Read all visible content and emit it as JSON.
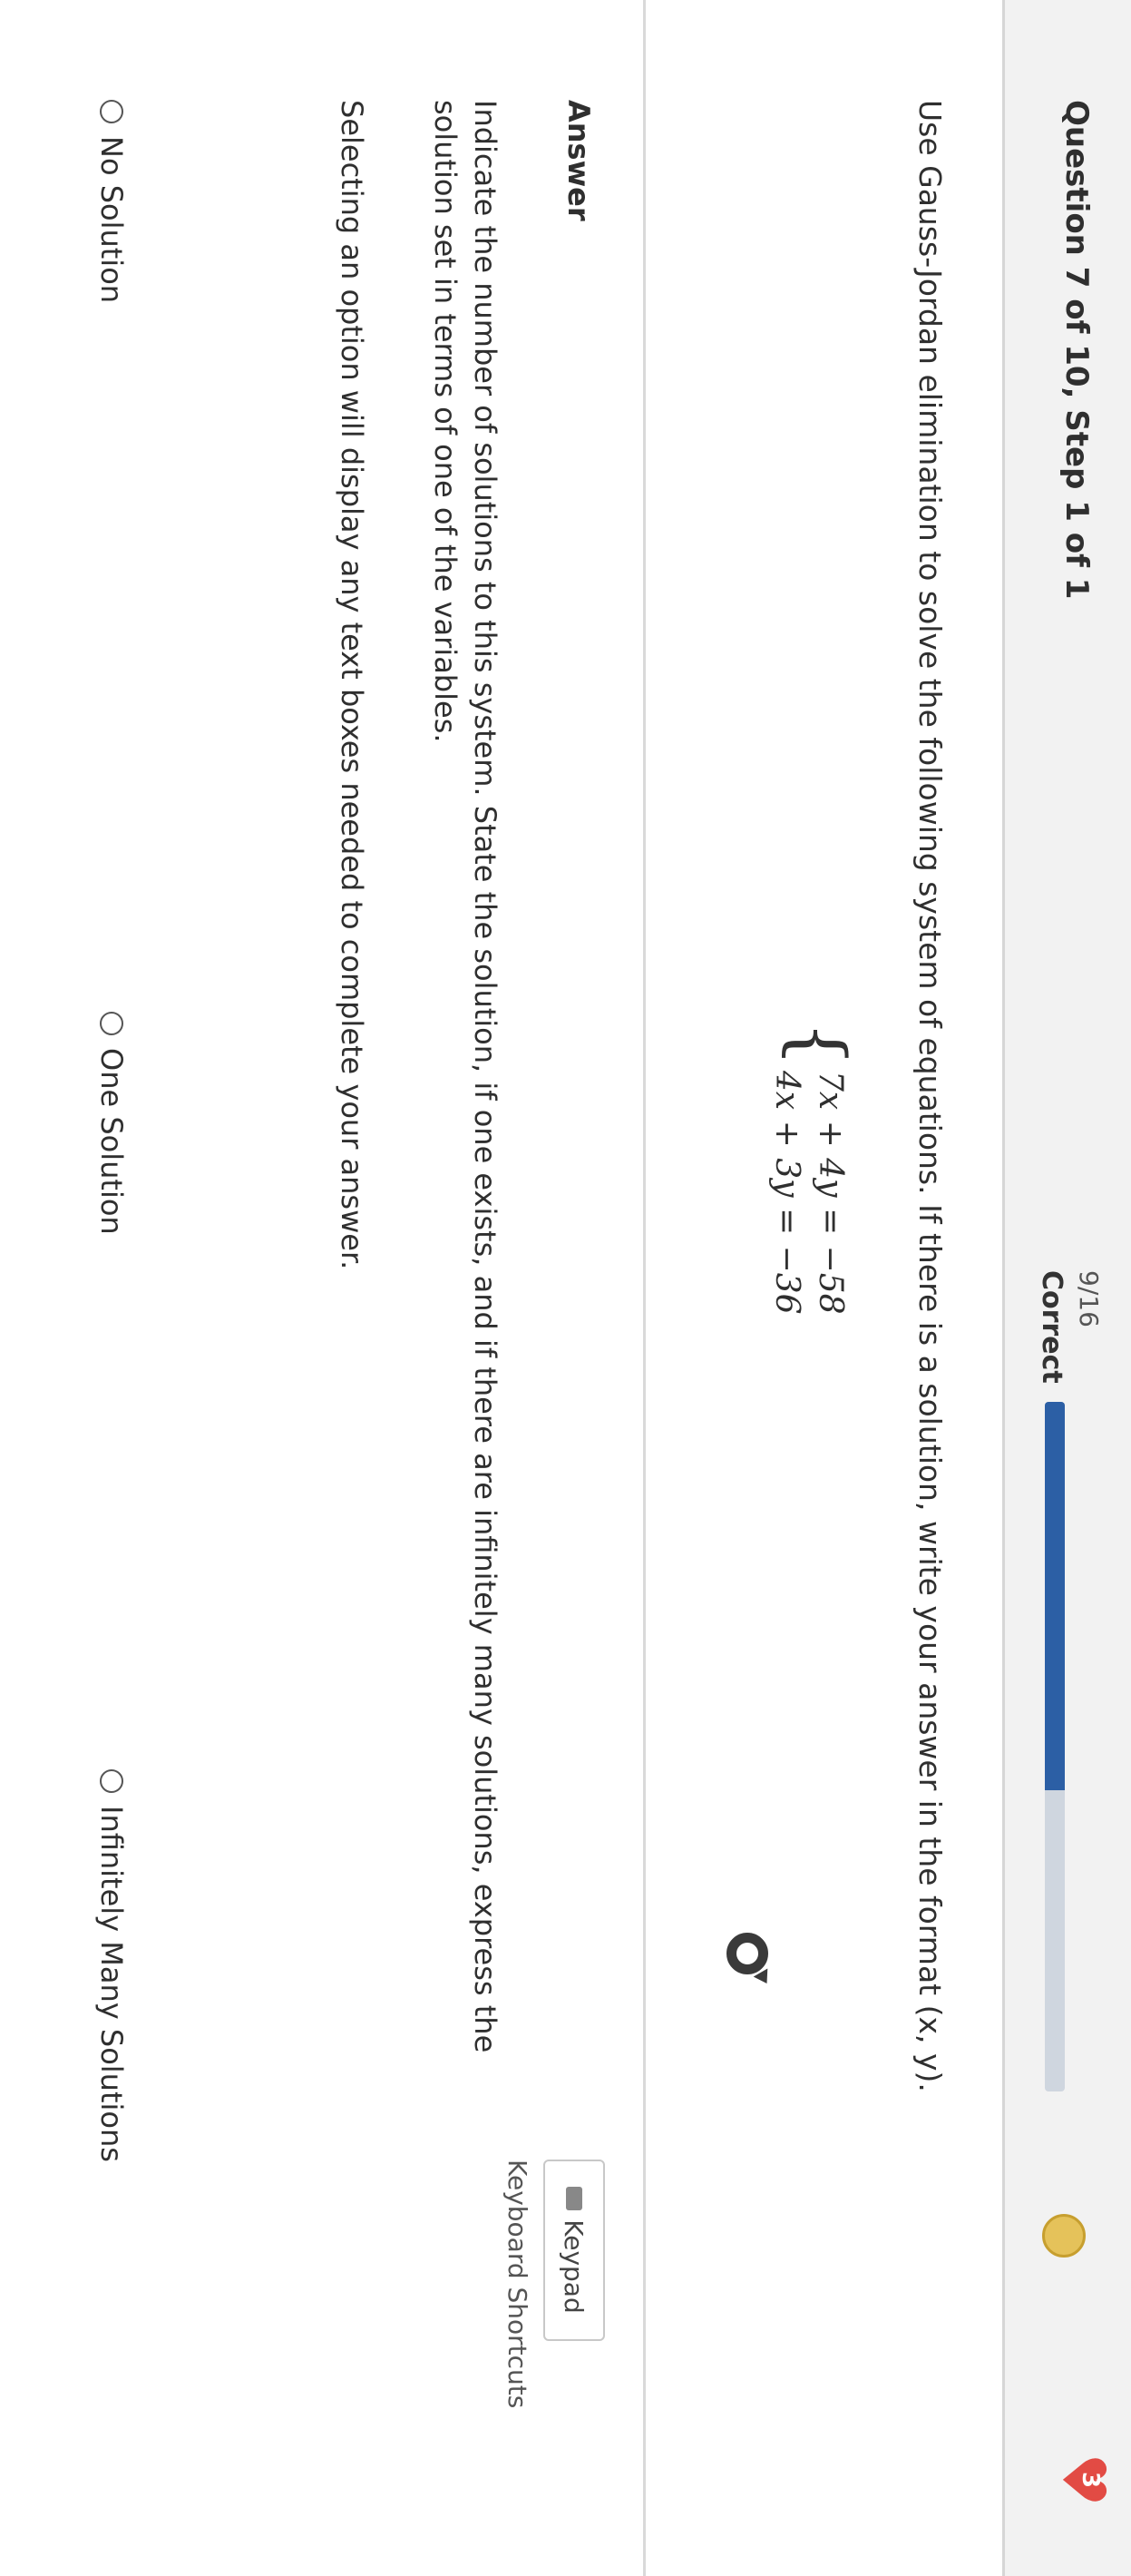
{
  "header": {
    "question_title": "Question 7 of 10, Step 1 of 1",
    "progress_count": "9/16",
    "progress_label": "Correct",
    "progress_fraction": 0.5625,
    "lives": "3",
    "accent_color": "#2c5fa5",
    "heart_color": "#e24b44"
  },
  "question": {
    "instructions": "Use Gauss-Jordan elimination to solve the following system of equations. If there is a solution, write your answer in the format (x, y).",
    "equations": [
      "7x + 4y = −58",
      "4x + 3y = −36"
    ]
  },
  "answer": {
    "heading": "Answer",
    "keypad_label": "Keypad",
    "keyboard_shortcuts_label": "Keyboard Shortcuts",
    "instructions": "Indicate the number of solutions to this system. State the solution, if one exists, and if there are infinitely many solutions, express the solution set in terms of one of the variables.",
    "selection_note": "Selecting an option will display any text boxes needed to complete your answer.",
    "options": [
      "No Solution",
      "One Solution",
      "Infinitely Many Solutions"
    ]
  }
}
